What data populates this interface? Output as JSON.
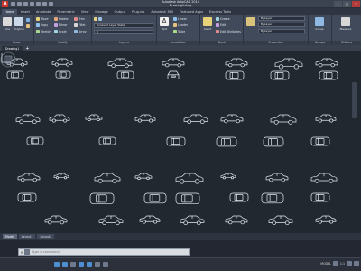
{
  "window": {
    "app_title": "Autodesk AutoCAD 2014",
    "file_title": "Drawing1.dwg"
  },
  "ribbon_tabs": [
    "Home",
    "Insert",
    "Annotate",
    "Parametric",
    "View",
    "Manage",
    "Output",
    "Plug-ins",
    "Autodesk 360",
    "Featured Apps",
    "Express Tools"
  ],
  "active_tab": "Home",
  "ribbon": {
    "draw": {
      "title": "Draw",
      "line": "Line",
      "polyline": "Polyline",
      "circle": "Circle",
      "arc": "Arc"
    },
    "modify": {
      "title": "Modify",
      "move": "Move",
      "rotate": "Rotate",
      "trim": "Trim",
      "copy": "Copy",
      "mirror": "Mirror",
      "fillet": "Fillet",
      "stretch": "Stretch",
      "scale": "Scale",
      "array": "Array"
    },
    "layers": {
      "title": "Layers",
      "current_layer": "0",
      "state": "Unsaved Layer State"
    },
    "annotation": {
      "title": "Annotation",
      "text": "Text",
      "dimension": "Dimension",
      "linear": "Linear",
      "leader": "Leader",
      "table": "Table"
    },
    "block": {
      "title": "Block",
      "insert": "Insert",
      "create": "Create",
      "edit": "Edit",
      "edit_attributes": "Edit Attributes"
    },
    "properties": {
      "title": "Properties",
      "color": "ByLayer",
      "linetype": "ByLayer",
      "lineweight": "ByLayer"
    },
    "groups": {
      "title": "Groups",
      "group": "Group"
    },
    "utilities": {
      "title": "Utilities",
      "measure": "Measure"
    }
  },
  "file_tabs": [
    "Drawing1"
  ],
  "layout_tabs": [
    "Model",
    "Layout1",
    "Layout2"
  ],
  "active_layout": "Model",
  "command_line": {
    "placeholder": "Type a command"
  },
  "status": {
    "model_label": "MODEL",
    "scale": "1:1"
  },
  "colors": {
    "canvas": "#212830",
    "ribbon": "#414a5a",
    "linework": "#e8ecf2"
  }
}
